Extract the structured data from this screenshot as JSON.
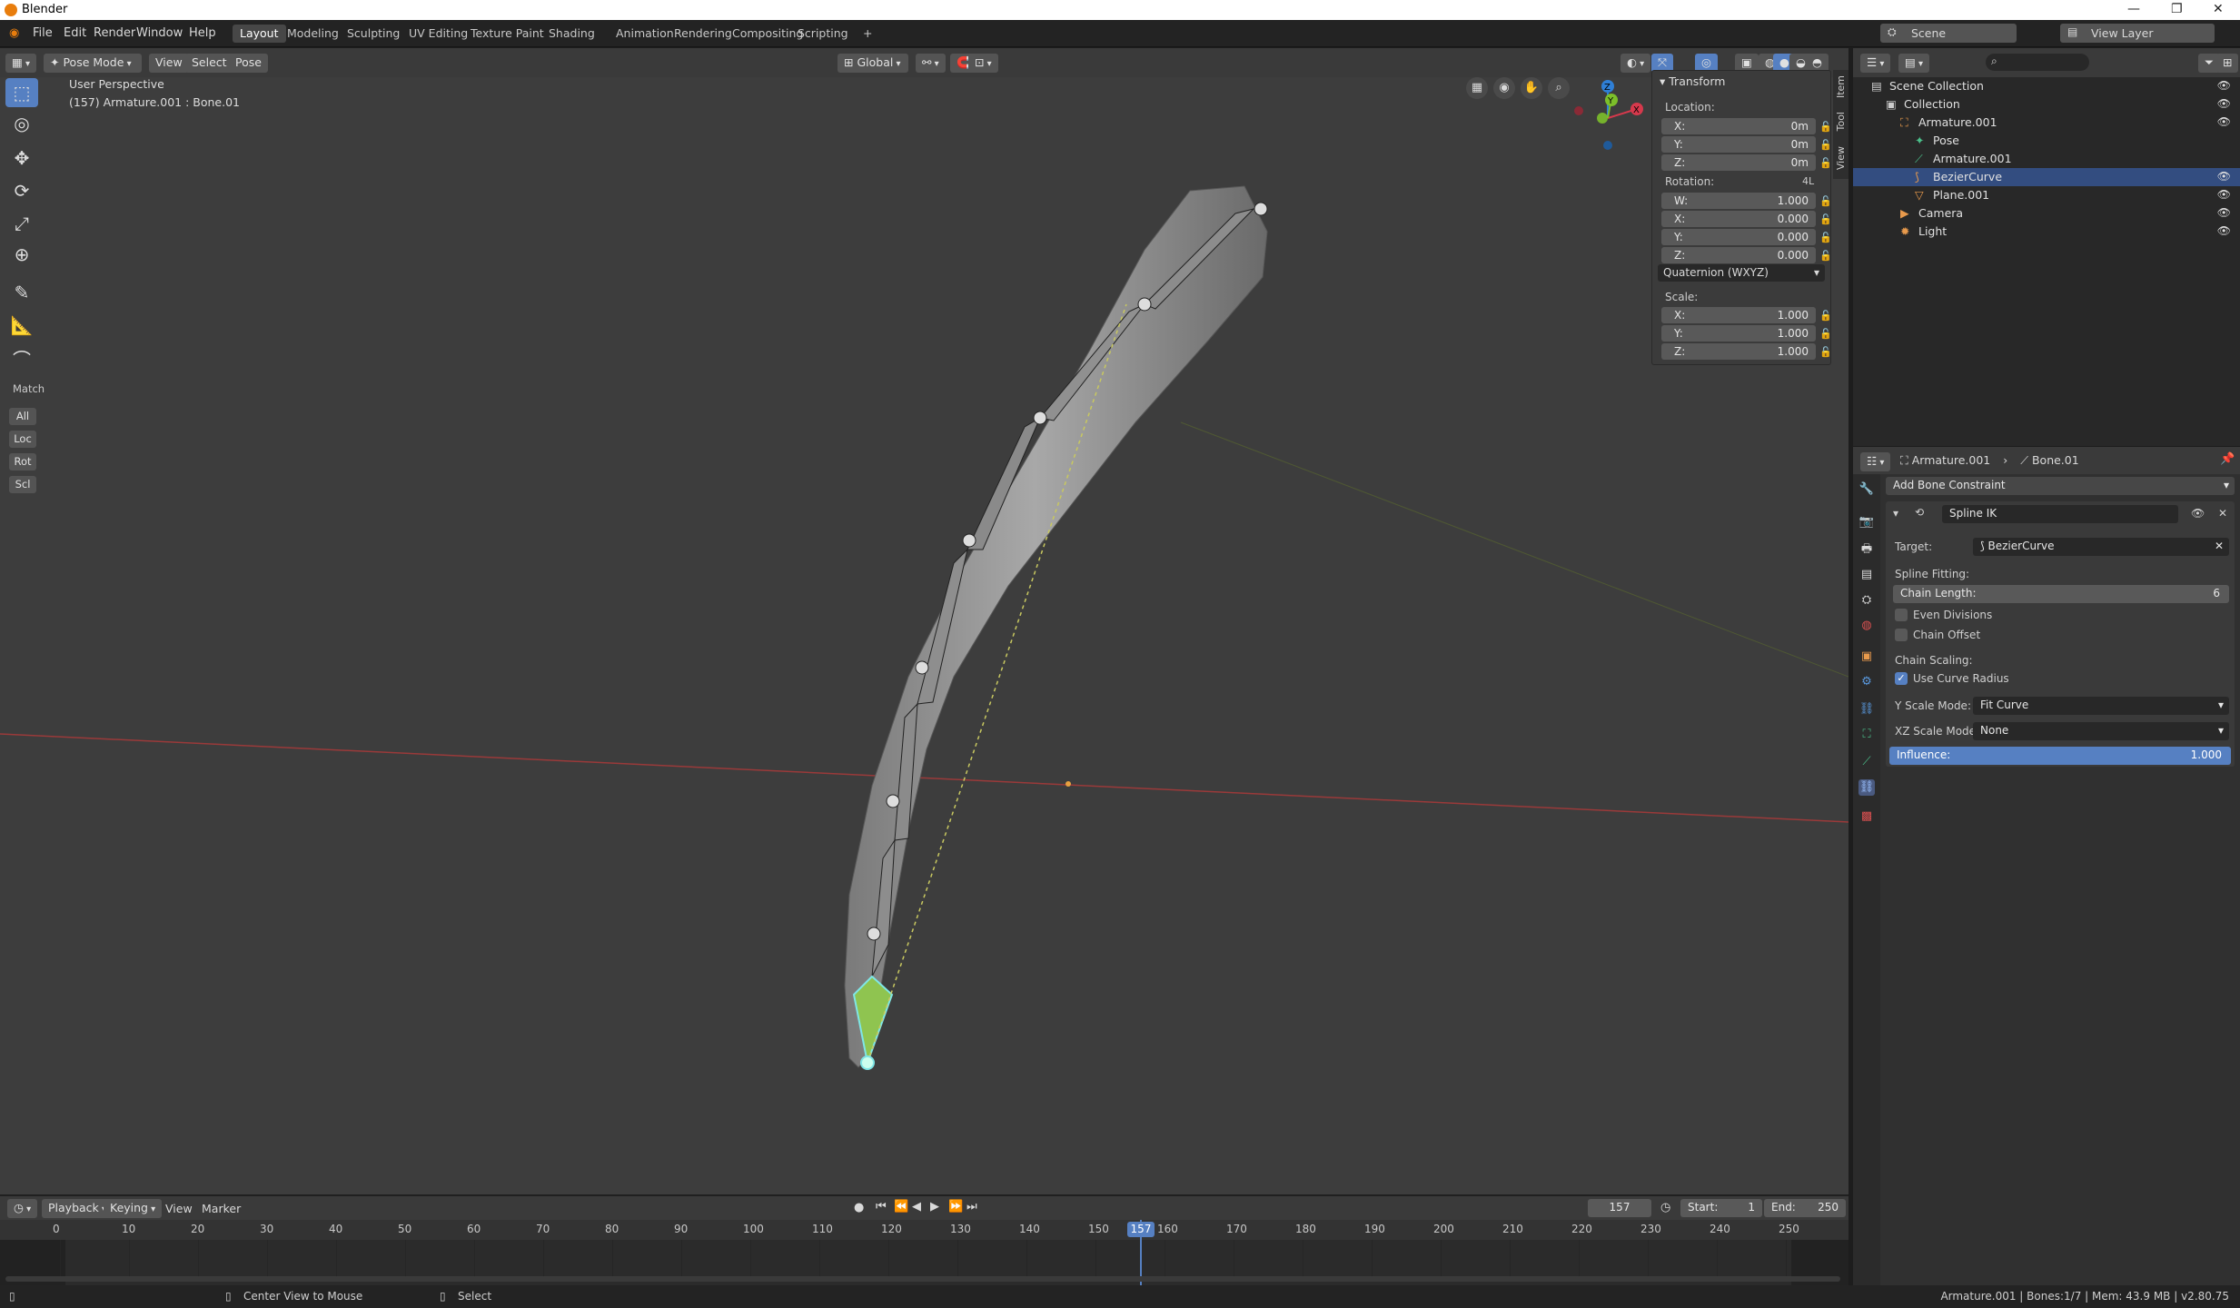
{
  "window": {
    "title": "Blender"
  },
  "menu": [
    "File",
    "Edit",
    "Render",
    "Window",
    "Help"
  ],
  "workspaces": [
    "Layout",
    "Modeling",
    "Sculpting",
    "UV Editing",
    "Texture Paint",
    "Shading",
    "Animation",
    "Rendering",
    "Compositing",
    "Scripting",
    "+"
  ],
  "active_workspace": "Layout",
  "scene": {
    "name": "Scene",
    "view_layer": "View Layer"
  },
  "viewport_header": {
    "mode": "Pose Mode",
    "view": "View",
    "select": "Select",
    "pose": "Pose",
    "orientation": "Global"
  },
  "viewport": {
    "perspective": "User Perspective",
    "object_info": "(157) Armature.001 : Bone.01"
  },
  "toolbar": {
    "match_label": "Match",
    "match_buttons": [
      "All",
      "Loc",
      "Rot",
      "Scl"
    ]
  },
  "gizmo": {
    "z": "Z",
    "y": "Y",
    "x": "X"
  },
  "transform": {
    "header": "Transform",
    "location_label": "Location:",
    "location": [
      {
        "k": "X:",
        "v": "0m"
      },
      {
        "k": "Y:",
        "v": "0m"
      },
      {
        "k": "Z:",
        "v": "0m"
      }
    ],
    "rotation_label": "Rotation:",
    "rotation_mode_tag": "4L",
    "rotation": [
      {
        "k": "W:",
        "v": "1.000"
      },
      {
        "k": "X:",
        "v": "0.000"
      },
      {
        "k": "Y:",
        "v": "0.000"
      },
      {
        "k": "Z:",
        "v": "0.000"
      }
    ],
    "rotation_mode": "Quaternion (WXYZ)",
    "scale_label": "Scale:",
    "scale": [
      {
        "k": "X:",
        "v": "1.000"
      },
      {
        "k": "Y:",
        "v": "1.000"
      },
      {
        "k": "Z:",
        "v": "1.000"
      }
    ]
  },
  "side_tabs": [
    "Item",
    "Tool",
    "View"
  ],
  "outliner": {
    "rows": [
      {
        "label": "Scene Collection",
        "indent": 0,
        "icon": "scene-collection-icon",
        "color": "#cccccc"
      },
      {
        "label": "Collection",
        "indent": 1,
        "icon": "collection-icon",
        "color": "#cccccc"
      },
      {
        "label": "Armature.001",
        "indent": 2,
        "icon": "armature-icon",
        "color": "#e89a4c"
      },
      {
        "label": "Pose",
        "indent": 3,
        "icon": "pose-icon",
        "color": "#4bbf8a"
      },
      {
        "label": "Armature.001",
        "indent": 3,
        "icon": "armature-data-icon",
        "color": "#4bbf8a"
      },
      {
        "label": "BezierCurve",
        "indent": 3,
        "icon": "curve-icon",
        "color": "#e89a4c"
      },
      {
        "label": "Plane.001",
        "indent": 3,
        "icon": "mesh-icon",
        "color": "#e89a4c"
      },
      {
        "label": "Camera",
        "indent": 2,
        "icon": "camera-icon",
        "color": "#e89a4c"
      },
      {
        "label": "Light",
        "indent": 2,
        "icon": "light-icon",
        "color": "#e89a4c"
      }
    ],
    "selected_index": 5
  },
  "properties": {
    "breadcrumb_object": "Armature.001",
    "breadcrumb_bone": "Bone.01",
    "add_constraint": "Add Bone Constraint",
    "constraint_name": "Spline IK",
    "target_label": "Target:",
    "target_value": "BezierCurve",
    "spline_fitting": "Spline Fitting:",
    "chain_length_label": "Chain Length:",
    "chain_length_value": "6",
    "even_divisions": "Even Divisions",
    "chain_offset": "Chain Offset",
    "chain_scaling": "Chain Scaling:",
    "use_curve_radius": "Use Curve Radius",
    "y_scale_label": "Y Scale Mode:",
    "y_scale_value": "Fit Curve",
    "xz_scale_label": "XZ Scale Mode:",
    "xz_scale_value": "None",
    "influence_label": "Influence:",
    "influence_value": "1.000"
  },
  "timeline": {
    "playback": "Playback",
    "keying": "Keying",
    "view": "View",
    "marker": "Marker",
    "current_frame": "157",
    "start_label": "Start:",
    "start": "1",
    "end_label": "End:",
    "end": "250",
    "ticks": [
      "0",
      "10",
      "20",
      "30",
      "40",
      "50",
      "60",
      "70",
      "80",
      "90",
      "100",
      "110",
      "120",
      "130",
      "140",
      "150",
      "160",
      "170",
      "180",
      "190",
      "200",
      "210",
      "220",
      "230",
      "240",
      "250"
    ]
  },
  "statusbar": {
    "hint1": "Center View to Mouse",
    "hint2": "Select",
    "stats": "Armature.001 | Bones:1/7 | Mem: 43.9 MB | v2.80.75"
  },
  "colors": {
    "accent": "#5680c2",
    "active_bone": "#8fc450",
    "x_axis": "#d6394c",
    "y_axis": "#7cbf2a",
    "z_axis": "#2f7fd6"
  }
}
